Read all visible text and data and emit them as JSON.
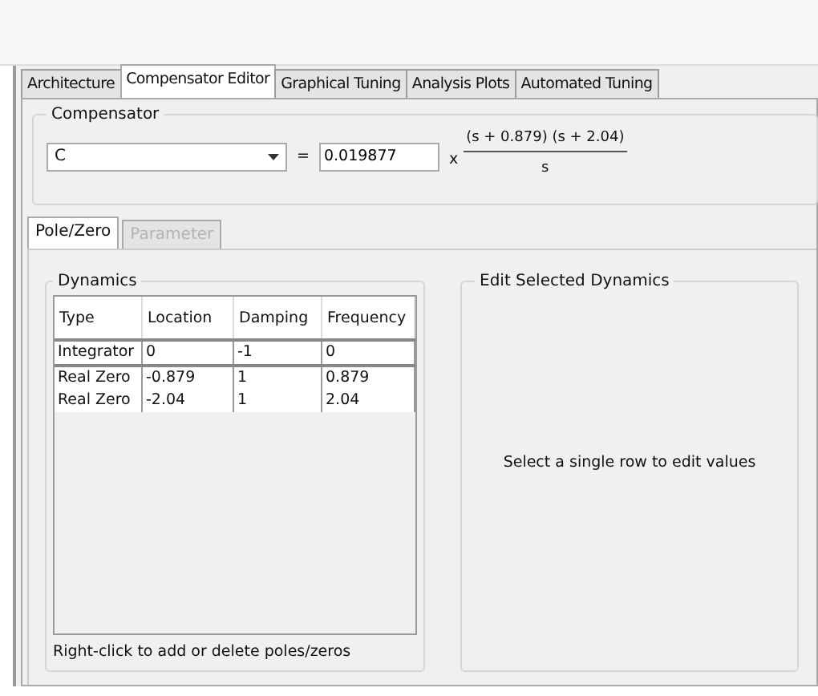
{
  "tabs": [
    {
      "label": "Architecture",
      "selected": false
    },
    {
      "label": "Compensator Editor",
      "selected": true
    },
    {
      "label": "Graphical Tuning",
      "selected": false
    },
    {
      "label": "Analysis Plots",
      "selected": false
    },
    {
      "label": "Automated Tuning",
      "selected": false
    }
  ],
  "compensator": {
    "title": "Compensator",
    "name": "C",
    "equals": "=",
    "gain": "0.019877",
    "times": "x",
    "numerator": "(s + 0.879) (s + 2.04)",
    "denominator": "s"
  },
  "subtabs": [
    {
      "label": "Pole/Zero",
      "selected": true,
      "disabled": false
    },
    {
      "label": "Parameter",
      "selected": false,
      "disabled": true
    }
  ],
  "dynamics": {
    "title": "Dynamics",
    "columns": [
      "Type",
      "Location",
      "Damping",
      "Frequency"
    ],
    "groups": [
      [
        [
          "Integrator",
          "0",
          "-1",
          "0"
        ]
      ],
      [
        [
          "Real Zero",
          "-0.879",
          "1",
          "0.879"
        ],
        [
          "Real Zero",
          "-2.04",
          "1",
          "2.04"
        ]
      ]
    ],
    "hint": "Right-click to add or delete poles/zeros"
  },
  "edit": {
    "title": "Edit Selected Dynamics",
    "message": "Select a single row to edit values"
  }
}
